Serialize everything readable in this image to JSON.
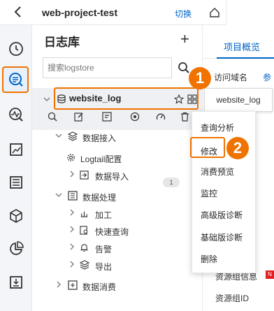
{
  "header": {
    "project_name": "web-project-test",
    "switch_label": "切换"
  },
  "sidebar_rail": {
    "items": [
      {
        "icon": "clock-icon"
      },
      {
        "icon": "log-search-icon",
        "active": true
      },
      {
        "icon": "monitor-icon"
      },
      {
        "icon": "chart-board-icon"
      },
      {
        "icon": "list-icon"
      },
      {
        "icon": "cube-icon"
      },
      {
        "icon": "pie-icon"
      },
      {
        "icon": "download-box-icon"
      }
    ]
  },
  "panel": {
    "title": "日志库",
    "add_label": "+",
    "search_placeholder": "搜索logstore",
    "logstore_name": "website_log",
    "tree": {
      "data_ingest": "数据接入",
      "logtail_config": "Logtail配置",
      "logtail_count": "1",
      "data_import": "数据导入",
      "data_processing": "数据处理",
      "process": "加工",
      "quick_query": "快速查询",
      "alert": "告警",
      "export": "导出",
      "data_consume": "数据消费"
    }
  },
  "context_menu": {
    "items": [
      "查询分析",
      "修改",
      "消费预览",
      "监控",
      "高级版诊断",
      "基础版诊断",
      "删除"
    ]
  },
  "annotations": {
    "step1": "1",
    "step2": "2"
  },
  "right_panel": {
    "tab_label": "项目概览",
    "access_domain": "访问域名",
    "access_link": "参",
    "tooltip": "website_log",
    "resource_group_info": "资源组信息",
    "new_tag": "N",
    "resource_group_id": "资源组ID"
  },
  "colors": {
    "accent": "#f07300",
    "link": "#0064c8",
    "rail_bg": "#f3f5f8"
  }
}
